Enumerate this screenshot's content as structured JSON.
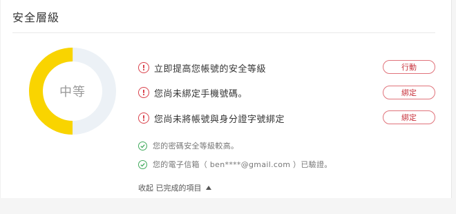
{
  "section": {
    "title": "安全層級"
  },
  "level": {
    "label": "中等",
    "fraction": 0.5,
    "filled_color": "#f9d400",
    "empty_color": "#ecf1f6"
  },
  "alerts": [
    {
      "text": "立即提高您帳號的安全等級",
      "button": "行動"
    },
    {
      "text": "您尚未綁定手機號碼。",
      "button": "綁定"
    },
    {
      "text": "您尚未將帳號與身分證字號綁定",
      "button": "綁定"
    }
  ],
  "completed": [
    {
      "text": "您的密碼安全等級較高。"
    },
    {
      "text": "您的電子信箱（ ben****@gmail.com ）已驗證。"
    }
  ],
  "collapse": {
    "label": "收起 已完成的項目"
  },
  "colors": {
    "alert": "#d9404a",
    "success": "#3faa5b"
  },
  "icons": {
    "alert": "exclamation-circle-icon",
    "success": "check-circle-icon",
    "collapse": "triangle-up-icon"
  }
}
